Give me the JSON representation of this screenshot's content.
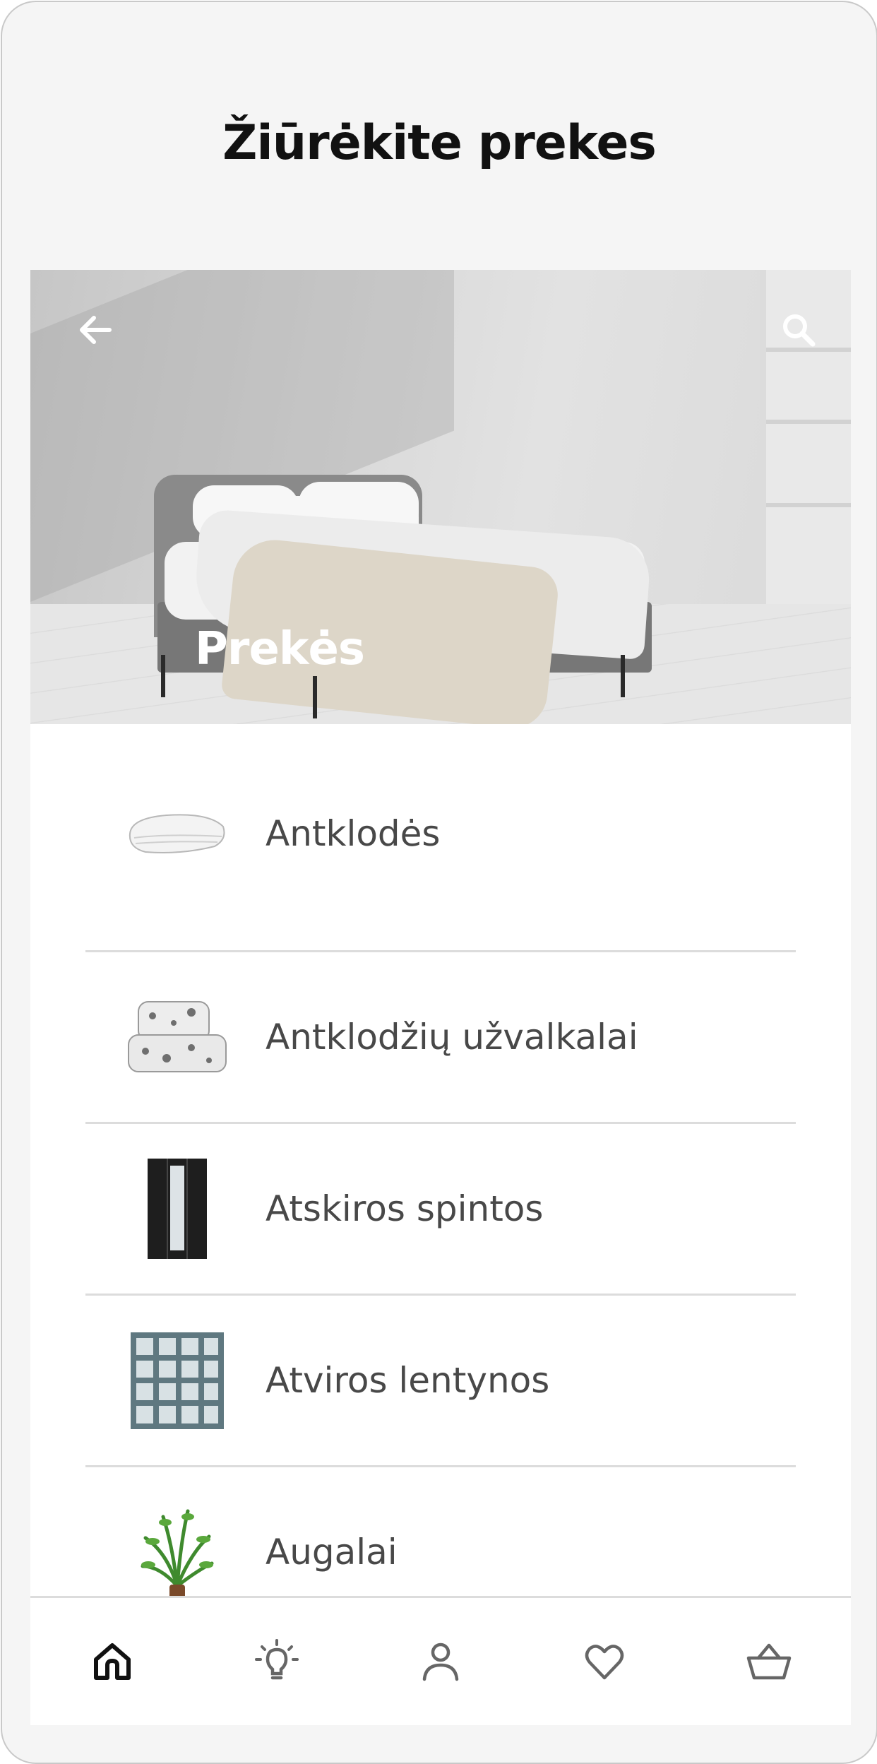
{
  "header": {
    "title": "Žiūrėkite prekes"
  },
  "hero": {
    "title": "Prekės",
    "back_icon": "arrow-left-icon",
    "search_icon": "search-icon"
  },
  "categories": [
    {
      "label": "Antklodės",
      "icon": "duvet-thumbnail"
    },
    {
      "label": "Antklodžių užvalkalai",
      "icon": "duvet-cover-thumbnail"
    },
    {
      "label": "Atskiros spintos",
      "icon": "wardrobe-thumbnail"
    },
    {
      "label": "Atviros lentynos",
      "icon": "open-shelving-thumbnail"
    },
    {
      "label": "Augalai",
      "icon": "plant-thumbnail"
    }
  ],
  "bottom_nav": [
    {
      "icon": "home-icon",
      "active": true
    },
    {
      "icon": "lightbulb-icon",
      "active": false
    },
    {
      "icon": "profile-icon",
      "active": false
    },
    {
      "icon": "heart-icon",
      "active": false
    },
    {
      "icon": "basket-icon",
      "active": false
    }
  ],
  "colors": {
    "background": "#f5f5f5",
    "text_primary": "#111111",
    "list_text": "#484848",
    "divider": "#dcdcdc",
    "nav_active": "#111111",
    "nav_inactive": "#666666"
  }
}
